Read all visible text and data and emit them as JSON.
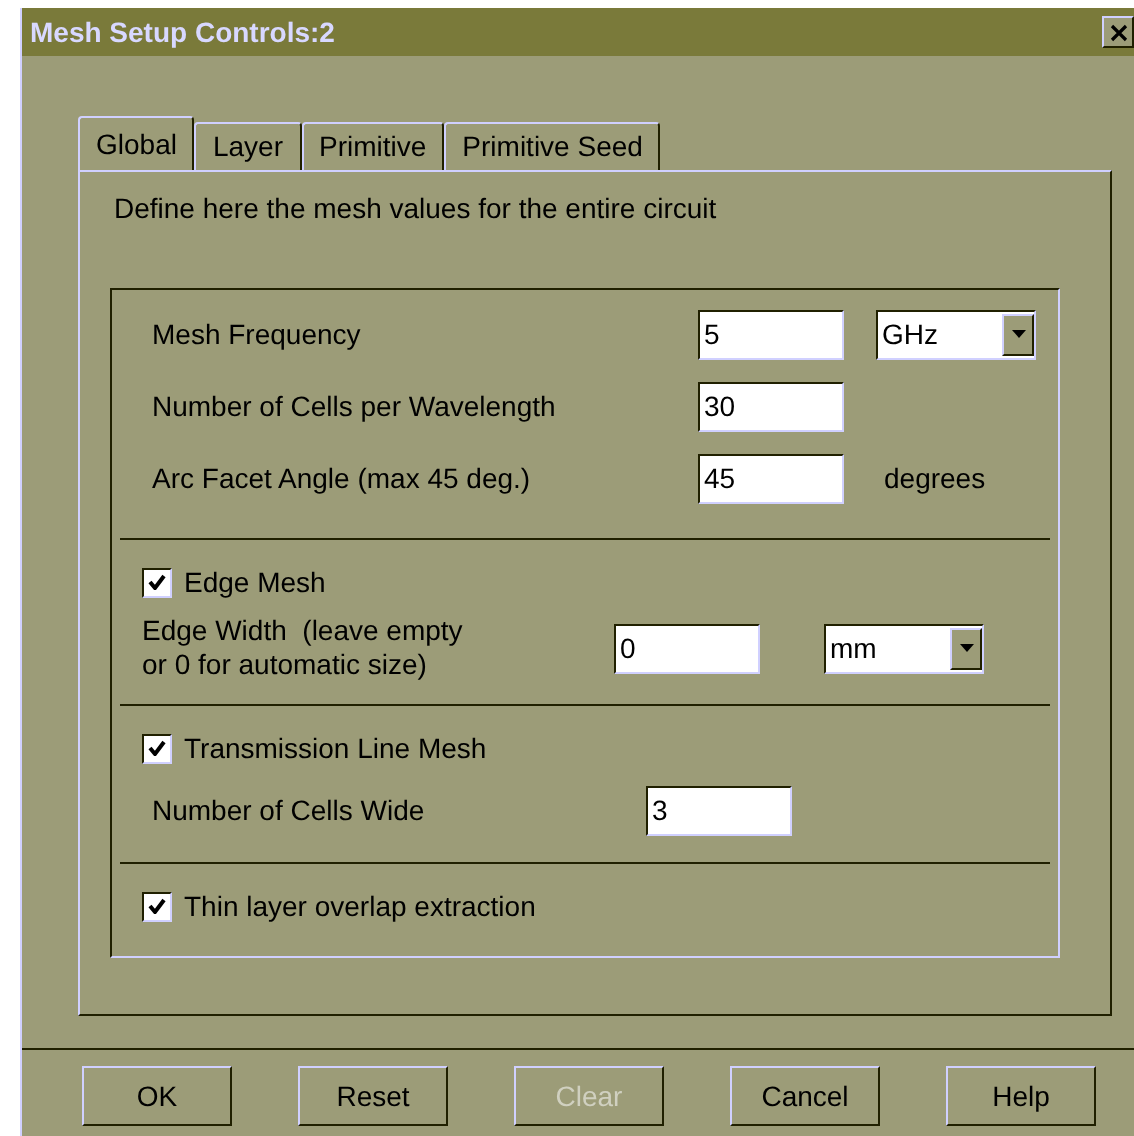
{
  "window": {
    "title": "Mesh Setup Controls:2"
  },
  "tabs": [
    {
      "label": "Global",
      "selected": true
    },
    {
      "label": "Layer",
      "selected": false
    },
    {
      "label": "Primitive",
      "selected": false
    },
    {
      "label": "Primitive Seed",
      "selected": false
    }
  ],
  "description": "Define here the mesh values for the entire circuit",
  "sections": [
    {
      "rows": [
        {
          "kind": "field",
          "label": "Mesh Frequency",
          "value": "5",
          "unit": {
            "kind": "select",
            "value": "GHz"
          }
        },
        {
          "kind": "field",
          "label": "Number of Cells per Wavelength",
          "value": "30"
        },
        {
          "kind": "field",
          "label": "Arc Facet Angle (max 45 deg.)",
          "value": "45",
          "unit": {
            "kind": "text",
            "value": "degrees"
          }
        }
      ]
    },
    {
      "rows": [
        {
          "kind": "checkbox",
          "label": "Edge Mesh",
          "checked": true
        },
        {
          "kind": "field",
          "label": "Edge Width  (leave empty\nor 0 for automatic size)",
          "value": "0",
          "unit": {
            "kind": "select",
            "value": "mm"
          }
        }
      ]
    },
    {
      "rows": [
        {
          "kind": "checkbox",
          "label": "Transmission Line Mesh",
          "checked": true
        },
        {
          "kind": "field",
          "label": "Number of Cells Wide",
          "value": "3"
        }
      ]
    },
    {
      "rows": [
        {
          "kind": "checkbox",
          "label": "Thin layer overlap extraction",
          "checked": true
        }
      ]
    }
  ],
  "buttons": [
    {
      "label": "OK",
      "disabled": false
    },
    {
      "label": "Reset",
      "disabled": false
    },
    {
      "label": "Clear",
      "disabled": true
    },
    {
      "label": "Cancel",
      "disabled": false
    },
    {
      "label": "Help",
      "disabled": false
    }
  ]
}
